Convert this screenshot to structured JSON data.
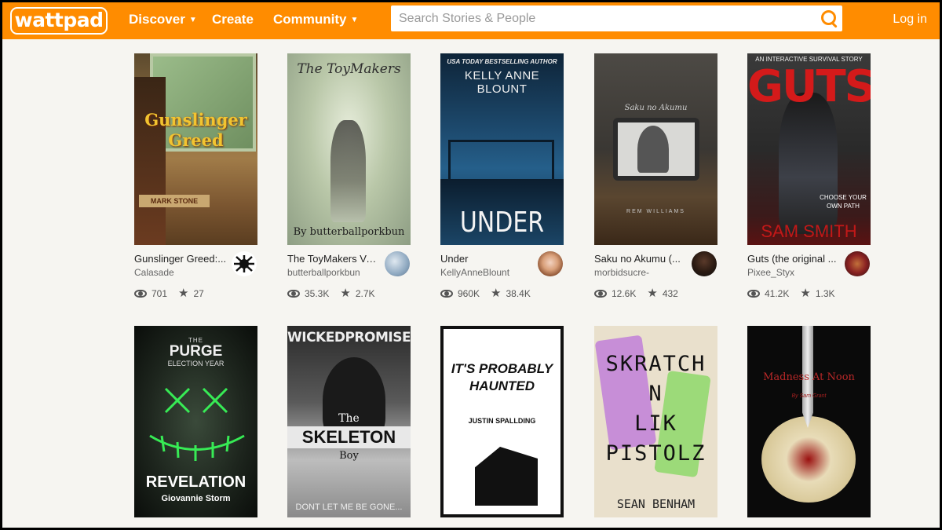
{
  "header": {
    "logo": "wattpad",
    "nav": [
      {
        "label": "Discover",
        "has_caret": true
      },
      {
        "label": "Create",
        "has_caret": false
      },
      {
        "label": "Community",
        "has_caret": true
      }
    ],
    "search_placeholder": "Search Stories & People",
    "login": "Log in",
    "accent_color": "#ff8c00"
  },
  "stories": [
    {
      "title": "Gunslinger Greed:...",
      "author": "Calasade",
      "reads": "701",
      "votes": "27",
      "cover_lines": [
        "Gunslinger",
        "Greed"
      ],
      "sub": "MARK STONE"
    },
    {
      "title": "The ToyMakers Vo...",
      "author": "butterballporkbun",
      "reads": "35.3K",
      "votes": "2.7K",
      "cover_lines": [
        "The ToyMakers"
      ],
      "sub": "By butterballporkbun"
    },
    {
      "title": "Under",
      "author": "KellyAnneBlount",
      "reads": "960K",
      "votes": "38.4K",
      "cover_lines": [
        "USA TODAY BESTSELLING AUTHOR",
        "KELLY ANNE BLOUNT"
      ],
      "sub": "UNDER"
    },
    {
      "title": "Saku no Akumu (...",
      "author": "morbidsucre-",
      "reads": "12.6K",
      "votes": "432",
      "cover_lines": [
        "Saku no Akumu"
      ],
      "sub": "REM WILLIAMS"
    },
    {
      "title": "Guts (the original ...",
      "author": "Pixee_Styx",
      "reads": "41.2K",
      "votes": "1.3K",
      "cover_lines": [
        "AN INTERACTIVE SURVIVAL STORY",
        "GUTS"
      ],
      "sub": "SAM SMITH",
      "tag": "CHOOSE YOUR OWN PATH"
    },
    {
      "title": "",
      "author": "",
      "reads": "",
      "votes": "",
      "cover_lines": [
        "THE",
        "PURGE",
        "ELECTION YEAR"
      ],
      "sub": "REVELATION",
      "tag": "Giovannie Storm"
    },
    {
      "title": "",
      "author": "",
      "reads": "",
      "votes": "",
      "cover_lines": [
        "WICKEDPROMISES",
        "The",
        "SKELETON",
        "Boy"
      ],
      "sub": "DONT LET ME BE GONE..."
    },
    {
      "title": "",
      "author": "",
      "reads": "",
      "votes": "",
      "cover_lines": [
        "IT'S PROBABLY",
        "HAUNTED"
      ],
      "sub": "JUSTIN SPALLDING"
    },
    {
      "title": "",
      "author": "",
      "reads": "",
      "votes": "",
      "cover_lines": [
        "SKRATCH",
        "N",
        "LIK",
        "PISTOLZ"
      ],
      "sub": "SEAN BENHAM"
    },
    {
      "title": "",
      "author": "",
      "reads": "",
      "votes": "",
      "cover_lines": [
        "Madness At Noon"
      ],
      "sub": "By Sam Grant"
    }
  ]
}
